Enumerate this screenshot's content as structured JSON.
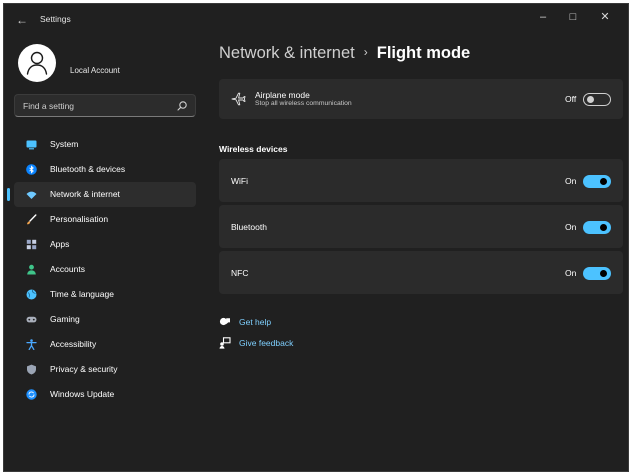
{
  "window": {
    "title": "Settings",
    "back_glyph": "←",
    "minimize_glyph": "–",
    "maximize_glyph": "□",
    "close_glyph": "✕"
  },
  "account": {
    "name": "Local Account"
  },
  "search": {
    "placeholder": "Find a setting",
    "icon": "search-icon"
  },
  "sidebar": {
    "items": [
      {
        "label": "System",
        "icon": "monitor-icon",
        "color": "#4cc2ff",
        "active": false
      },
      {
        "label": "Bluetooth & devices",
        "icon": "bluetooth-icon",
        "color": "#0a84ff",
        "active": false
      },
      {
        "label": "Network & internet",
        "icon": "wifi-icon",
        "color": "#6fc9ff",
        "active": true
      },
      {
        "label": "Personalisation",
        "icon": "brush-icon",
        "color": "#f0a24c",
        "active": false
      },
      {
        "label": "Apps",
        "icon": "apps-icon",
        "color": "#9aa7c8",
        "active": false
      },
      {
        "label": "Accounts",
        "icon": "person-icon",
        "color": "#3fc58a",
        "active": false
      },
      {
        "label": "Time & language",
        "icon": "globe-clock-icon",
        "color": "#4cc2ff",
        "active": false
      },
      {
        "label": "Gaming",
        "icon": "gamepad-icon",
        "color": "#aab0bc",
        "active": false
      },
      {
        "label": "Accessibility",
        "icon": "accessibility-icon",
        "color": "#4aa8ff",
        "active": false
      },
      {
        "label": "Privacy & security",
        "icon": "shield-icon",
        "color": "#9aa4b4",
        "active": false
      },
      {
        "label": "Windows Update",
        "icon": "update-icon",
        "color": "#1e90ff",
        "active": false
      }
    ]
  },
  "breadcrumb": {
    "parent": "Network & internet",
    "separator": "›",
    "current": "Flight mode"
  },
  "airplane": {
    "title": "Airplane mode",
    "subtitle": "Stop all wireless communication",
    "state_label": "Off",
    "enabled": false
  },
  "wireless": {
    "section_title": "Wireless devices",
    "devices": [
      {
        "label": "WiFi",
        "state_label": "On",
        "enabled": true
      },
      {
        "label": "Bluetooth",
        "state_label": "On",
        "enabled": true
      },
      {
        "label": "NFC",
        "state_label": "On",
        "enabled": true
      }
    ]
  },
  "links": {
    "help": "Get help",
    "feedback": "Give feedback"
  },
  "colors": {
    "accent": "#4cc2ff",
    "window_bg": "#202020",
    "card_bg": "#2b2b2b",
    "link": "#7fd0ff"
  }
}
